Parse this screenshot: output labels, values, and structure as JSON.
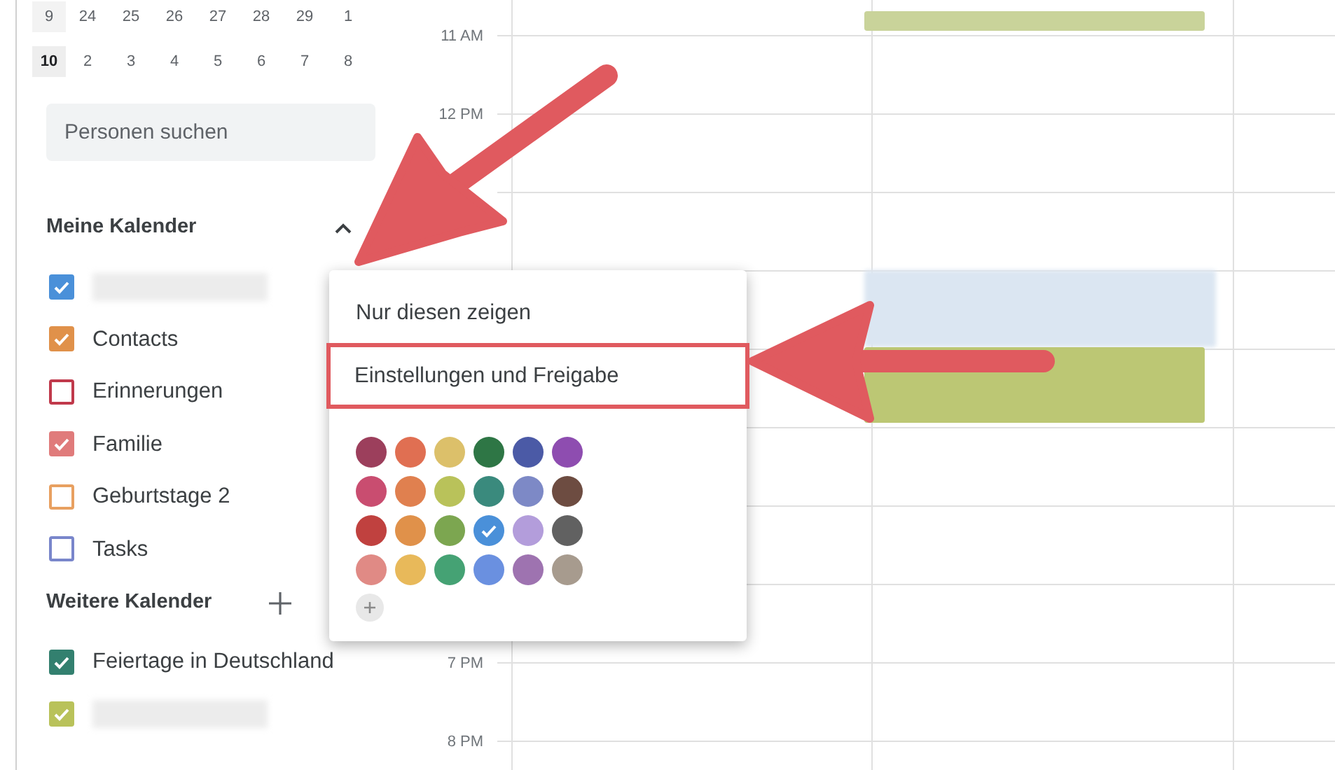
{
  "mini_calendar": {
    "rows": [
      {
        "week": "9",
        "days": [
          "24",
          "25",
          "26",
          "27",
          "28",
          "29",
          "1"
        ],
        "current": false
      },
      {
        "week": "10",
        "days": [
          "2",
          "3",
          "4",
          "5",
          "6",
          "7",
          "8"
        ],
        "current": true
      }
    ]
  },
  "search": {
    "placeholder": "Personen suchen"
  },
  "my_calendars": {
    "title": "Meine Kalender",
    "expanded": true,
    "items": [
      {
        "kind": "blurred",
        "color": "#4a90d9",
        "checked": true
      },
      {
        "kind": "named",
        "label": "Contacts",
        "color": "#e0914a",
        "checked": true
      },
      {
        "kind": "named",
        "label": "Erinnerungen",
        "color": "#c0394b",
        "checked": false
      },
      {
        "kind": "named",
        "label": "Familie",
        "color": "#e07b7b",
        "checked": true
      },
      {
        "kind": "named",
        "label": "Geburtstage 2",
        "color": "#e8a060",
        "checked": false
      },
      {
        "kind": "named",
        "label": "Tasks",
        "color": "#7986cb",
        "checked": false
      }
    ]
  },
  "other_calendars": {
    "title": "Weitere Kalender",
    "items": [
      {
        "kind": "named",
        "label": "Feiertage in Deutschland",
        "color": "#33806f",
        "checked": true
      },
      {
        "kind": "blurred",
        "color": "#b9c25a",
        "checked": true
      }
    ]
  },
  "time_labels": [
    "11 AM",
    "12 PM",
    "7 PM",
    "8 PM"
  ],
  "events": [
    {
      "color": "#c9d39a",
      "kind": "plain"
    },
    {
      "color": "#dbe6f2",
      "kind": "blurred"
    },
    {
      "color": "#bcc774",
      "kind": "plain"
    }
  ],
  "context_menu": {
    "items": [
      {
        "label": "Nur diesen zeigen",
        "annotated": false
      },
      {
        "label": "Einstellungen und Freigabe",
        "annotated": true
      }
    ],
    "colors": [
      {
        "color": "#9c3f5c",
        "selected": false
      },
      {
        "color": "#e06f52",
        "selected": false
      },
      {
        "color": "#dcc06a",
        "selected": false
      },
      {
        "color": "#2e7645",
        "selected": false
      },
      {
        "color": "#4b5aa6",
        "selected": false
      },
      {
        "color": "#8e4db0",
        "selected": false
      },
      {
        "color": "#c94d70",
        "selected": false
      },
      {
        "color": "#e0804f",
        "selected": false
      },
      {
        "color": "#b9c25a",
        "selected": false
      },
      {
        "color": "#3a8a7d",
        "selected": false
      },
      {
        "color": "#7d89c6",
        "selected": false
      },
      {
        "color": "#6d4c41",
        "selected": false
      },
      {
        "color": "#c0413f",
        "selected": false
      },
      {
        "color": "#e0914a",
        "selected": false
      },
      {
        "color": "#7ca650",
        "selected": false
      },
      {
        "color": "#4a90d9",
        "selected": true
      },
      {
        "color": "#b39ddb",
        "selected": false
      },
      {
        "color": "#616161",
        "selected": false
      },
      {
        "color": "#e08a85",
        "selected": false
      },
      {
        "color": "#e8b95a",
        "selected": false
      },
      {
        "color": "#45a274",
        "selected": false
      },
      {
        "color": "#6a90e0",
        "selected": false
      },
      {
        "color": "#9e73b0",
        "selected": false
      },
      {
        "color": "#a79b8e",
        "selected": false
      }
    ]
  }
}
